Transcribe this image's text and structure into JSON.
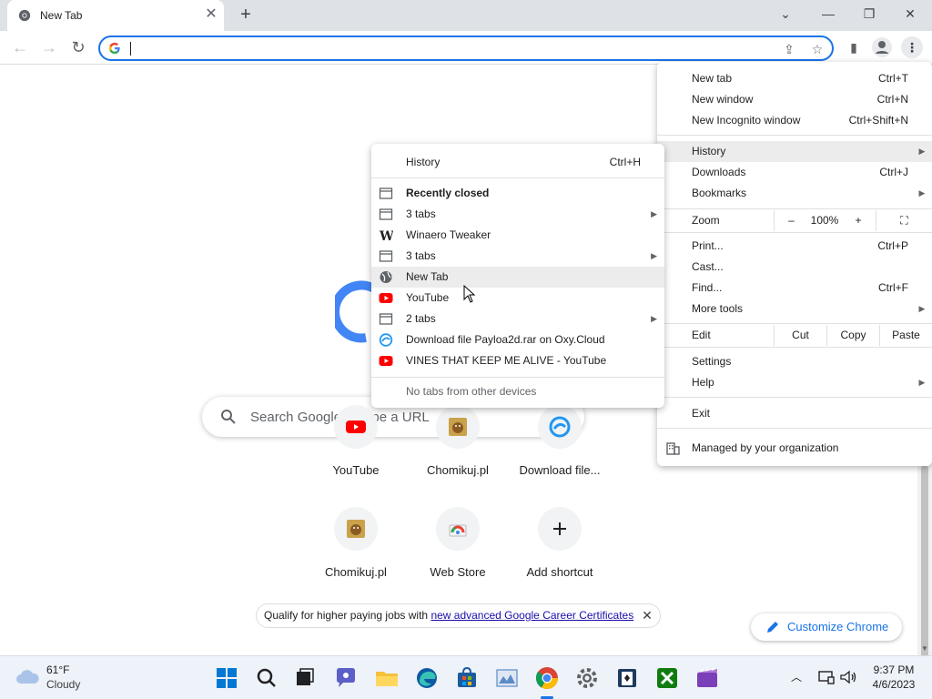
{
  "tab": {
    "title": "New Tab"
  },
  "omnibox": {
    "value": ""
  },
  "search": {
    "placeholder": "Search Google or type a URL"
  },
  "shortcuts": [
    {
      "label": "YouTube"
    },
    {
      "label": "Chomikuj.pl"
    },
    {
      "label": "Download file..."
    },
    {
      "label": "Chomikuj.pl"
    },
    {
      "label": "Web Store"
    },
    {
      "label": "Add shortcut"
    }
  ],
  "promo": {
    "text": "Qualify for higher paying jobs with ",
    "link": "new advanced Google Career Certificates"
  },
  "customize": {
    "label": "Customize Chrome"
  },
  "main_menu": {
    "new_tab": {
      "label": "New tab",
      "shortcut": "Ctrl+T"
    },
    "new_window": {
      "label": "New window",
      "shortcut": "Ctrl+N"
    },
    "new_incognito": {
      "label": "New Incognito window",
      "shortcut": "Ctrl+Shift+N"
    },
    "history": {
      "label": "History"
    },
    "downloads": {
      "label": "Downloads",
      "shortcut": "Ctrl+J"
    },
    "bookmarks": {
      "label": "Bookmarks"
    },
    "zoom": {
      "label": "Zoom",
      "minus": "–",
      "value": "100%",
      "plus": "+"
    },
    "print": {
      "label": "Print...",
      "shortcut": "Ctrl+P"
    },
    "cast": {
      "label": "Cast..."
    },
    "find": {
      "label": "Find...",
      "shortcut": "Ctrl+F"
    },
    "more_tools": {
      "label": "More tools"
    },
    "edit": {
      "label": "Edit",
      "cut": "Cut",
      "copy": "Copy",
      "paste": "Paste"
    },
    "settings": {
      "label": "Settings"
    },
    "help": {
      "label": "Help"
    },
    "exit": {
      "label": "Exit"
    },
    "managed": {
      "label": "Managed by your organization"
    }
  },
  "history_menu": {
    "history": {
      "label": "History",
      "shortcut": "Ctrl+H"
    },
    "recently_closed": "Recently closed",
    "items": [
      {
        "label": "3 tabs",
        "icon": "window-icon",
        "submenu": true
      },
      {
        "label": "Winaero Tweaker",
        "icon": "winaero-icon",
        "submenu": false
      },
      {
        "label": "3 tabs",
        "icon": "window-icon",
        "submenu": true
      },
      {
        "label": "New Tab",
        "icon": "globe-icon",
        "submenu": false
      },
      {
        "label": "YouTube",
        "icon": "youtube-icon",
        "submenu": false
      },
      {
        "label": "2 tabs",
        "icon": "window-icon",
        "submenu": true
      },
      {
        "label": "Download file Payloa2d.rar on Oxy.Cloud",
        "icon": "oxycloud-icon",
        "submenu": false
      },
      {
        "label": "VINES THAT KEEP ME ALIVE - YouTube",
        "icon": "youtube-icon",
        "submenu": false
      }
    ],
    "no_tabs": "No tabs from other devices"
  },
  "taskbar": {
    "weather_temp": "61°F",
    "weather_desc": "Cloudy",
    "time": "9:37 PM",
    "date": "4/6/2023"
  },
  "colors": {
    "accent": "#1a73e8",
    "youtube": "#ff0000",
    "menu_highlight": "#ececec"
  }
}
